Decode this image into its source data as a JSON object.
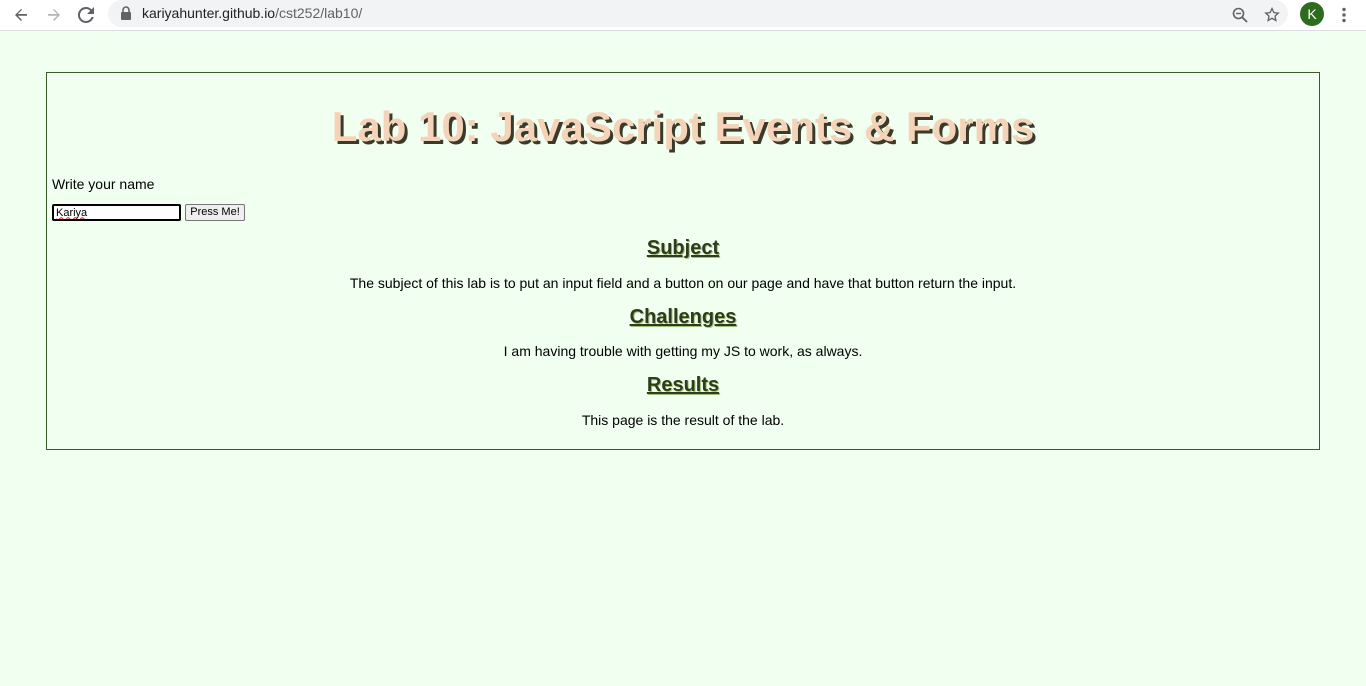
{
  "browser": {
    "url_host": "kariyahunter.github.io",
    "url_path": "/cst252/lab10/",
    "avatar_letter": "K",
    "icons": [
      "back-arrow-icon",
      "forward-arrow-icon",
      "reload-icon",
      "lock-icon",
      "zoom-icon",
      "star-icon",
      "kebab-menu-icon"
    ]
  },
  "page": {
    "title": "Lab 10: JavaScript Events & Forms",
    "name_prompt": "Write your name",
    "name_value": "Kariya",
    "button_label": "Press Me!",
    "sections": [
      {
        "heading": "Subject",
        "text": "The subject of this lab is to put an input field and a button on our page and have that button return the input."
      },
      {
        "heading": "Challenges",
        "text": "I am having trouble with getting my JS to work, as always."
      },
      {
        "heading": "Results",
        "text": "This page is the result of the lab."
      }
    ]
  },
  "colors": {
    "page_background": "#f0fff0",
    "title_color": "#f5d3b8",
    "heading_color": "#2f3b1a",
    "border_color": "#3a5a2a"
  }
}
